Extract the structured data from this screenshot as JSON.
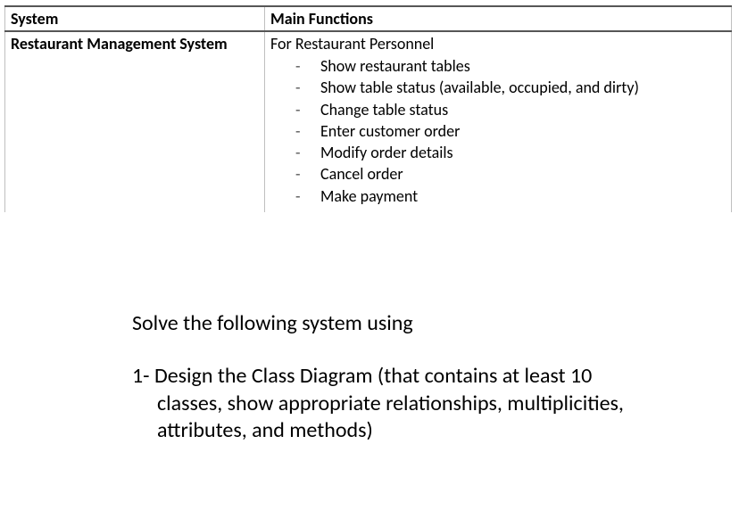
{
  "table": {
    "headers": {
      "col1": "System",
      "col2": "Main Functions"
    },
    "row": {
      "system": "Restaurant Management System",
      "functions_heading": "For Restaurant Personnel",
      "functions": [
        "Show restaurant tables",
        "Show table status (available, occupied, and dirty)",
        "Change table status",
        "Enter customer order",
        "Modify order details",
        "Cancel order",
        "Make payment"
      ]
    }
  },
  "question": {
    "prompt": "Solve the following system using",
    "item1": "1- Design the Class Diagram (that contains at least 10 classes, show appropriate relationships, multiplicities, attributes, and methods)"
  }
}
